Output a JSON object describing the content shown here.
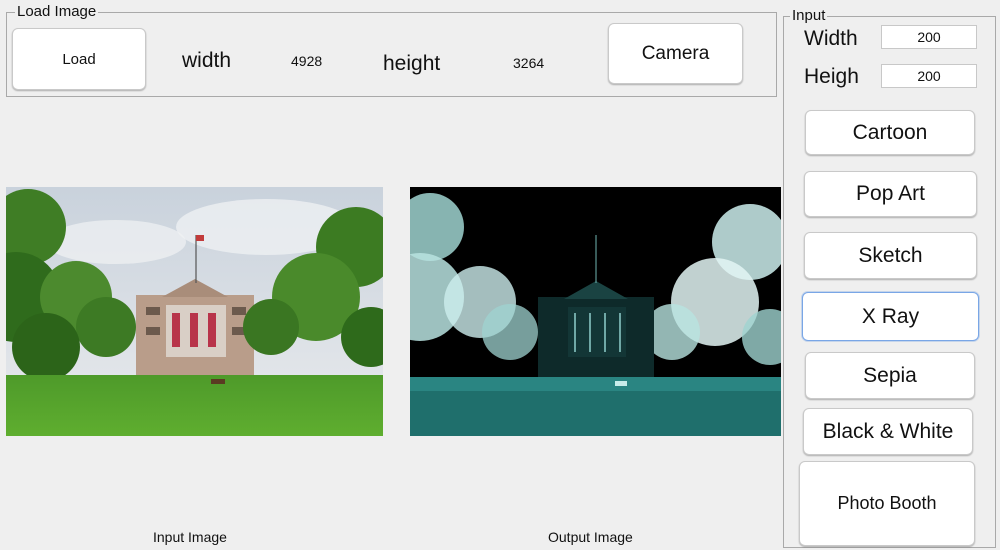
{
  "load_panel": {
    "title": "Load Image",
    "load_button": "Load",
    "width_label": "width",
    "width_value": "4928",
    "height_label": "height",
    "height_value": "3264",
    "camera_button": "Camera"
  },
  "images": {
    "input_label": "Input Image",
    "output_label": "Output Image"
  },
  "input_panel": {
    "title": "Input",
    "width_label": "Width",
    "width_value": "200",
    "height_label": "Heigh",
    "height_value": "200",
    "buttons": {
      "cartoon": "Cartoon",
      "pop_art": "Pop Art",
      "sketch": "Sketch",
      "xray": "X Ray",
      "sepia": "Sepia",
      "bw": "Black & White",
      "photo_booth": "Photo Booth"
    }
  },
  "colors": {
    "background": "#efefef",
    "button": "#ffffff",
    "focus_ring": "#79a6e6",
    "xray_tint": "#2f8f8c"
  }
}
